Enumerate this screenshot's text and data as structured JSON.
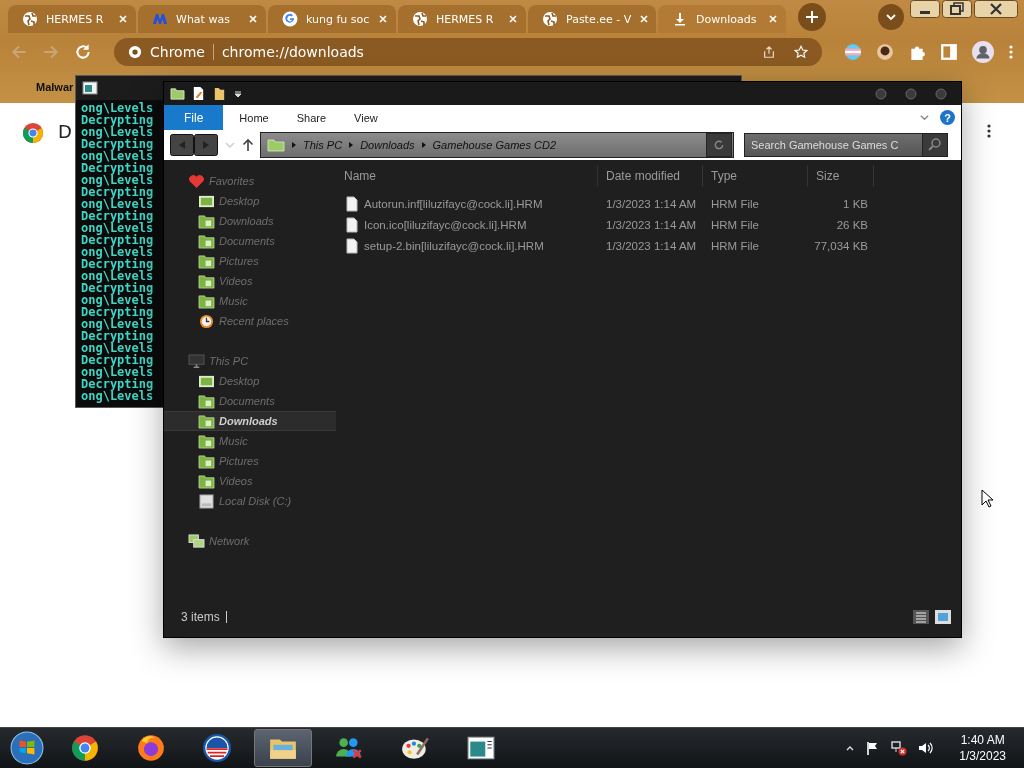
{
  "browser": {
    "tabs": [
      {
        "title": "HERMES R",
        "kind": "globe",
        "selected": false
      },
      {
        "title": "What was",
        "kind": "m",
        "selected": false
      },
      {
        "title": "kung fu soc",
        "kind": "google",
        "selected": false
      },
      {
        "title": "HERMES R",
        "kind": "globe",
        "selected": false
      },
      {
        "title": "Paste.ee - V",
        "kind": "globe",
        "selected": false
      },
      {
        "title": "Downloads",
        "kind": "download",
        "selected": true
      }
    ],
    "address": {
      "label": "Chrome",
      "url": "chrome://downloads"
    },
    "bookmarks": [
      "Malwar"
    ],
    "page": {
      "heading": "D"
    }
  },
  "console": {
    "lines": [
      "ong\\Levels",
      "Decrypting",
      "ong\\Levels",
      "Decrypting",
      "ong\\Levels",
      "Decrypting",
      "ong\\Levels",
      "Decrypting",
      "ong\\Levels",
      "Decrypting",
      "ong\\Levels",
      "Decrypting",
      "ong\\Levels",
      "Decrypting",
      "ong\\Levels",
      "Decrypting",
      "ong\\Levels",
      "Decrypting",
      "ong\\Levels",
      "Decrypting",
      "ong\\Levels",
      "Decrypting",
      "ong\\Levels",
      "Decrypting",
      "ong\\Levels"
    ]
  },
  "explorer": {
    "ribbon_tabs": [
      {
        "label": "File",
        "kind": "file"
      },
      {
        "label": "Home",
        "kind": "tab"
      },
      {
        "label": "Share",
        "kind": "tab"
      },
      {
        "label": "View",
        "kind": "tab"
      }
    ],
    "help": "?",
    "breadcrumb": [
      "This PC",
      "Downloads",
      "Gamehouse Games CD2"
    ],
    "search": {
      "placeholder": "Search Gamehouse Games C"
    },
    "nav": [
      {
        "label": "Favorites",
        "kind": "favorites",
        "children": [
          {
            "label": "Desktop",
            "kind": "desktop",
            "selected": false
          },
          {
            "label": "Downloads",
            "kind": "folder",
            "selected": false
          },
          {
            "label": "Documents",
            "kind": "folder",
            "selected": false
          },
          {
            "label": "Pictures",
            "kind": "folder",
            "selected": false
          },
          {
            "label": "Videos",
            "kind": "folder",
            "selected": false
          },
          {
            "label": "Music",
            "kind": "folder",
            "selected": false
          },
          {
            "label": "Recent places",
            "kind": "recent",
            "selected": false
          }
        ]
      },
      {
        "label": "This PC",
        "kind": "pc",
        "children": [
          {
            "label": "Desktop",
            "kind": "desktop",
            "selected": false
          },
          {
            "label": "Documents",
            "kind": "folder",
            "selected": false
          },
          {
            "label": "Downloads",
            "kind": "folder",
            "selected": true
          },
          {
            "label": "Music",
            "kind": "folder",
            "selected": false
          },
          {
            "label": "Pictures",
            "kind": "folder",
            "selected": false
          },
          {
            "label": "Videos",
            "kind": "folder",
            "selected": false
          },
          {
            "label": "Local Disk (C:)",
            "kind": "disk",
            "selected": false
          }
        ]
      },
      {
        "label": "Network",
        "kind": "network"
      }
    ],
    "columns": [
      "Name",
      "Date modified",
      "Type",
      "Size"
    ],
    "files": [
      {
        "name": "Autorun.inf[liluzifayc@cock.li].HRM",
        "date": "1/3/2023 1:14 AM",
        "type": "HRM File",
        "size": "1 KB"
      },
      {
        "name": "Icon.ico[liluzifayc@cock.li].HRM",
        "date": "1/3/2023 1:14 AM",
        "type": "HRM File",
        "size": "26 KB"
      },
      {
        "name": "setup-2.bin[liluzifayc@cock.li].HRM",
        "date": "1/3/2023 1:14 AM",
        "type": "HRM File",
        "size": "77,034 KB"
      }
    ],
    "status": "3 items"
  },
  "taskbar": {
    "apps": [
      {
        "kind": "chrome",
        "active": false
      },
      {
        "kind": "firefox",
        "active": false
      },
      {
        "kind": "circle",
        "active": false
      },
      {
        "kind": "explorer",
        "active": true
      },
      {
        "kind": "people",
        "active": false
      },
      {
        "kind": "paint",
        "active": false
      },
      {
        "kind": "window",
        "active": false
      }
    ],
    "clock": {
      "time": "1:40 AM",
      "date": "1/3/2023"
    }
  }
}
